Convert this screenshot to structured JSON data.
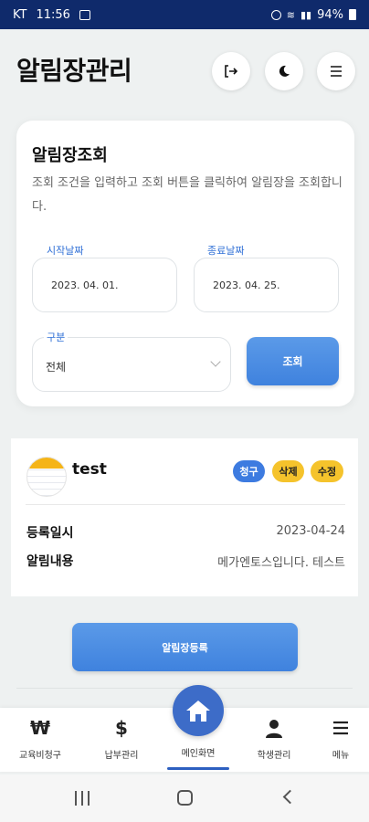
{
  "status_bar": {
    "carrier": "KT",
    "time": "11:56",
    "battery": "94%"
  },
  "header": {
    "title": "알림장관리"
  },
  "search_card": {
    "title": "알림장조회",
    "description": "조회 조건을 입력하고 조회 버튼을 클릭하여 알림장을 조회합니다.",
    "start_date": {
      "label": "시작날짜",
      "value": "2023. 04. 01."
    },
    "end_date": {
      "label": "종료날짜",
      "value": "2023. 04. 25."
    },
    "category": {
      "label": "구분",
      "value": "전체"
    },
    "search_button": "조회"
  },
  "notice": {
    "user": "test",
    "badges": {
      "charge": "청구",
      "delete": "삭제",
      "edit": "수정"
    },
    "registered_label": "등록일시",
    "registered_value": "2023-04-24",
    "content_label": "알림내용",
    "content_value": "메가엔토스입니다. 테스트"
  },
  "register_button": "알림장등록",
  "bottom_nav": {
    "education": {
      "icon": "₩",
      "label": "교육비청구"
    },
    "payment": {
      "icon": "$",
      "label": "납부관리"
    },
    "home": {
      "label": "메인화면"
    },
    "students": {
      "label": "학생관리"
    },
    "menu": {
      "label": "메뉴"
    }
  },
  "colors": {
    "accent": "#3f82de",
    "status_bar": "#0f2a6b",
    "badge_blue": "#3d7be0",
    "badge_yellow": "#f5c32c"
  },
  "icons": [
    "logout-icon",
    "moon-icon",
    "hamburger-icon",
    "won-icon",
    "dollar-icon",
    "home-icon",
    "person-icon",
    "menu-icon"
  ]
}
